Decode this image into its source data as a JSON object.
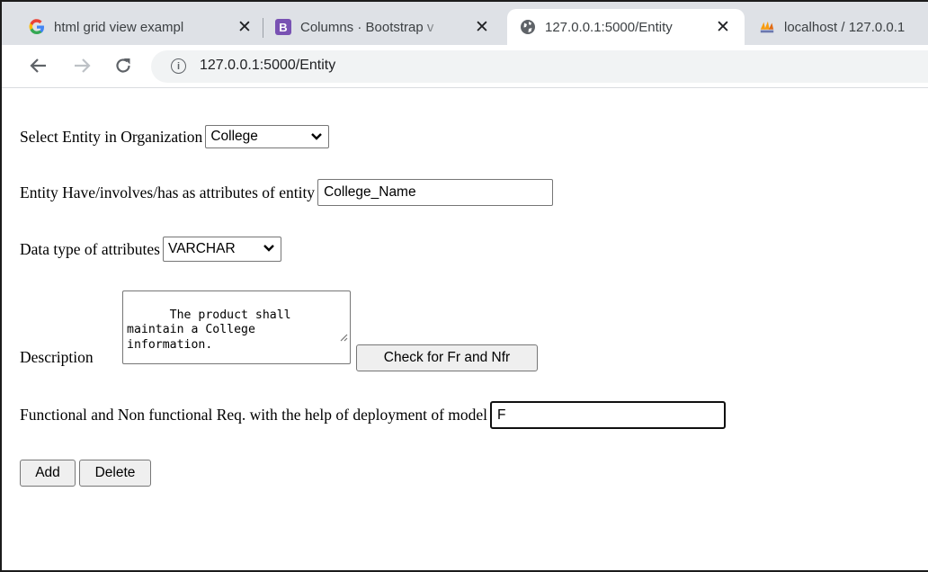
{
  "browser": {
    "tabs": [
      {
        "title": "html grid view exampl",
        "favicon": "google-icon",
        "active": false
      },
      {
        "title": "Columns · Bootstrap v",
        "favicon": "bootstrap-icon",
        "active": false
      },
      {
        "title": "127.0.0.1:5000/Entity",
        "favicon": "globe-icon",
        "active": true
      },
      {
        "title": "localhost / 127.0.0.1",
        "favicon": "phpmyadmin-icon",
        "active": false
      }
    ],
    "close_glyph": "✕",
    "url": "127.0.0.1:5000/Entity",
    "info_glyph": "i"
  },
  "form": {
    "entity_label": "Select Entity in Organization",
    "entity_value": "College",
    "attribute_label": "Entity Have/involves/has as attributes of entity",
    "attribute_value": "College_Name",
    "datatype_label": "Data type of attributes",
    "datatype_value": "VARCHAR",
    "description_label": "Description",
    "description_value": "The product shall\nmaintain a College\ninformation.",
    "check_button": "Check for Fr and Nfr",
    "fr_label": "Functional and Non functional Req. with the help of deployment of model",
    "fr_value": "F",
    "add_button": "Add",
    "delete_button": "Delete"
  },
  "colors": {
    "tabstrip_bg": "#dee1e6",
    "omnibox_bg": "#f1f3f4",
    "bootstrap_purple": "#7952b3",
    "google_blue": "#4285f4"
  }
}
